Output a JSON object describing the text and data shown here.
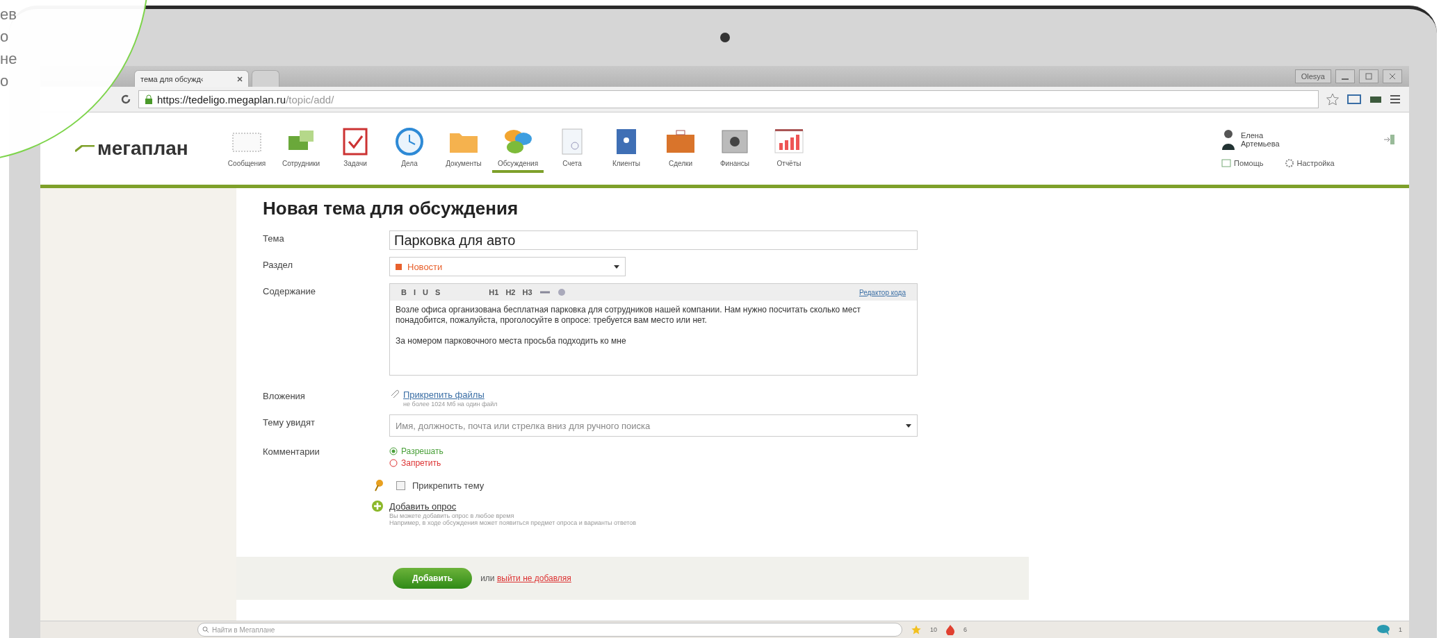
{
  "slide_text": [
    "ев",
    "о",
    "не",
    "о"
  ],
  "browser": {
    "tabs": [
      {
        "label": "тема для обсужд‹",
        "selected": true
      },
      {
        "selected": false
      }
    ],
    "profile": "Olesya",
    "url_host": "https://tedeligo.megaplan.ru",
    "url_path": "/topic/add/"
  },
  "app": {
    "logo": "мегаплан",
    "nav": [
      {
        "label": "Сообщения",
        "selected": false
      },
      {
        "label": "Сотрудники",
        "selected": false
      },
      {
        "label": "Задачи",
        "selected": false
      },
      {
        "label": "Дела",
        "selected": false
      },
      {
        "label": "Документы",
        "selected": false
      },
      {
        "label": "Обсуждения",
        "selected": true
      },
      {
        "label": "Счета",
        "selected": false
      },
      {
        "label": "Клиенты",
        "selected": false
      },
      {
        "label": "Сделки",
        "selected": false
      },
      {
        "label": "Финансы",
        "selected": false
      },
      {
        "label": "Отчёты",
        "selected": false
      }
    ],
    "user": {
      "first": "Елена",
      "last": "Артемьева"
    },
    "help": "Помощь",
    "settings": "Настройка"
  },
  "form": {
    "title": "Новая тема для обсуждения",
    "topic": {
      "label": "Тема",
      "value": "Парковка для авто"
    },
    "section": {
      "label": "Раздел",
      "value": "Новости",
      "color": "#e8602c"
    },
    "content": {
      "label": "Содержание",
      "toolbar": [
        "B",
        "I",
        "U",
        "S",
        "H1",
        "H2",
        "H3"
      ],
      "code_link": "Редактор кода",
      "paragraphs": [
        "Возле офиса организована бесплатная парковка для сотрудников нашей компании. Нам нужно посчитать сколько мест понадобится, пожалуйста, проголосуйте в опросе: требуется вам место или нет.",
        "За номером парковочного места просьба подходить ко мне"
      ]
    },
    "attachments": {
      "label": "Вложения",
      "link": "Прикрепить файлы",
      "hint": "не более 1024 Мб на один файл"
    },
    "audience": {
      "label": "Тему увидят",
      "placeholder": "Имя, должность, почта или стрелка вниз для ручного поиска"
    },
    "comments": {
      "label": "Комментарии",
      "options": [
        {
          "label": "Разрешать",
          "selected": true
        },
        {
          "label": "Запретить",
          "selected": false
        }
      ]
    },
    "pin": {
      "label": "Прикрепить тему",
      "checked": false
    },
    "poll": {
      "link": "Добавить опрос",
      "hints": [
        "Вы можете добавить опрос в любое время",
        "Например, в ходе обсуждения может появиться предмет опроса и варианты ответов"
      ]
    },
    "submit": "Добавить",
    "or": "или",
    "cancel": "выйти не добавляя"
  },
  "status_bar": {
    "search_placeholder": "Найти в Мегаплане",
    "stars": "10",
    "hot": "6",
    "chat": "1"
  }
}
